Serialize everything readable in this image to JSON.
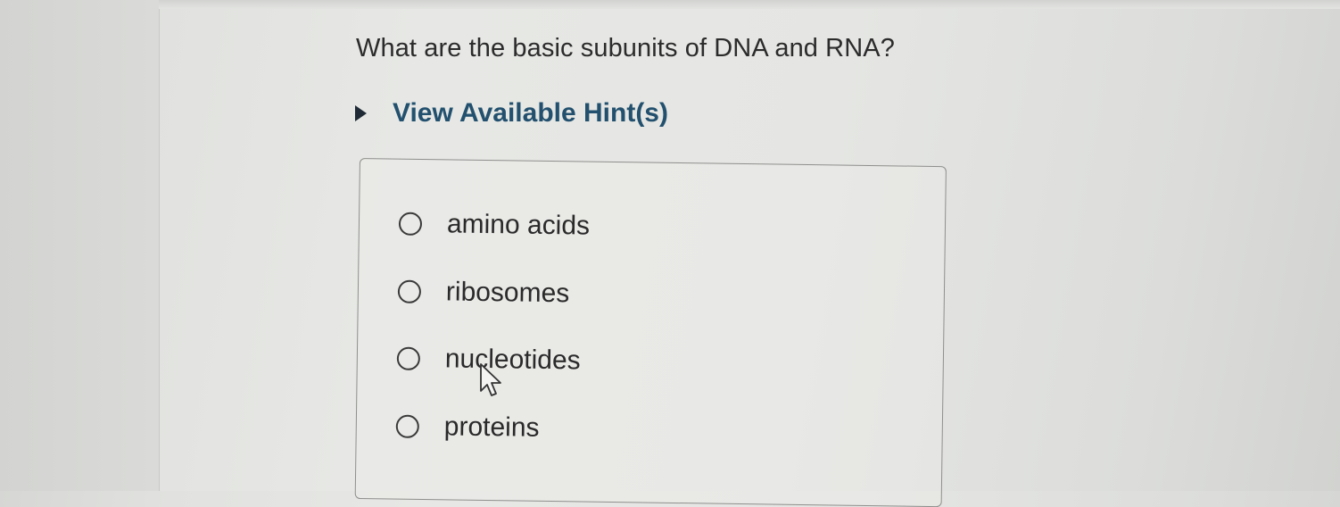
{
  "question": {
    "text": "What are the basic subunits of DNA and RNA?"
  },
  "hint": {
    "label": "View Available Hint(s)",
    "expanded": false
  },
  "options": [
    {
      "label": "amino acids",
      "selected": false
    },
    {
      "label": "ribosomes",
      "selected": false
    },
    {
      "label": "nucleotides",
      "selected": false
    },
    {
      "label": "proteins",
      "selected": false
    }
  ],
  "colors": {
    "hint_text": "#22506e",
    "question_text": "#2b2b2b",
    "box_border": "#8e8f8c"
  }
}
